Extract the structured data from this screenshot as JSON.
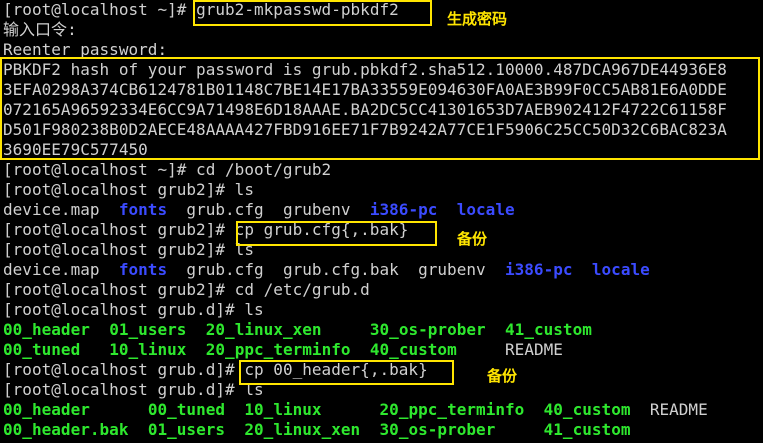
{
  "terminal": {
    "lines": [
      {
        "segments": [
          {
            "text": "[root@localhost ~]# ",
            "cls": "plain"
          },
          {
            "text": "grub2-mkpasswd-pbkdf2",
            "cls": "plain"
          }
        ]
      },
      {
        "segments": [
          {
            "text": "输入口令:",
            "cls": "plain"
          }
        ]
      },
      {
        "segments": [
          {
            "text": "Reenter password:",
            "cls": "plain"
          }
        ]
      },
      {
        "segments": [
          {
            "text": "PBKDF2 hash of your password is grub.pbkdf2.sha512.10000.487DCA967DE44936E8",
            "cls": "plain"
          }
        ]
      },
      {
        "segments": [
          {
            "text": "3EFA0298A374CB6124781B01148C7BE14E17BA33559E094630FA0AE3B99F0CC5AB81E6A0DDE",
            "cls": "plain"
          }
        ]
      },
      {
        "segments": [
          {
            "text": "072165A96592334E6CC9A71498E6D18AAAE.BA2DC5CC41301653D7AEB902412F4722C61158F",
            "cls": "plain"
          }
        ]
      },
      {
        "segments": [
          {
            "text": "D501F980238B0D2AECE48AAAA427FBD916EE71F7B9242A77CE1F5906C25CC50D32C6BAC823A",
            "cls": "plain"
          }
        ]
      },
      {
        "segments": [
          {
            "text": "3690EE79C577450",
            "cls": "plain"
          }
        ]
      },
      {
        "segments": [
          {
            "text": "[root@localhost ~]# cd /boot/grub2",
            "cls": "plain"
          }
        ]
      },
      {
        "segments": [
          {
            "text": "[root@localhost grub2]# ls",
            "cls": "plain"
          }
        ]
      },
      {
        "segments": [
          {
            "text": "device.map  ",
            "cls": "plain"
          },
          {
            "text": "fonts",
            "cls": "dir"
          },
          {
            "text": "  grub.cfg  grubenv  ",
            "cls": "plain"
          },
          {
            "text": "i386-pc",
            "cls": "dir"
          },
          {
            "text": "  ",
            "cls": "plain"
          },
          {
            "text": "locale",
            "cls": "dir"
          }
        ]
      },
      {
        "segments": [
          {
            "text": "[root@localhost grub2]# ",
            "cls": "plain"
          },
          {
            "text": "cp grub.cfg{,.bak}",
            "cls": "plain"
          }
        ]
      },
      {
        "segments": [
          {
            "text": "[root@localhost grub2]# ls",
            "cls": "plain"
          }
        ]
      },
      {
        "segments": [
          {
            "text": "device.map  ",
            "cls": "plain"
          },
          {
            "text": "fonts",
            "cls": "dir"
          },
          {
            "text": "  grub.cfg  grub.cfg.bak  grubenv  ",
            "cls": "plain"
          },
          {
            "text": "i386-pc",
            "cls": "dir"
          },
          {
            "text": "  ",
            "cls": "plain"
          },
          {
            "text": "locale",
            "cls": "dir"
          }
        ]
      },
      {
        "segments": [
          {
            "text": "[root@localhost grub2]# cd /etc/grub.d",
            "cls": "plain"
          }
        ]
      },
      {
        "segments": [
          {
            "text": "[root@localhost grub.d]# ls",
            "cls": "plain"
          }
        ]
      },
      {
        "segments": [
          {
            "text": "00_header",
            "cls": "exec"
          },
          {
            "text": "  ",
            "cls": "plain"
          },
          {
            "text": "01_users",
            "cls": "exec"
          },
          {
            "text": "  ",
            "cls": "plain"
          },
          {
            "text": "20_linux_xen",
            "cls": "exec"
          },
          {
            "text": "     ",
            "cls": "plain"
          },
          {
            "text": "30_os-prober",
            "cls": "exec"
          },
          {
            "text": "  ",
            "cls": "plain"
          },
          {
            "text": "41_custom",
            "cls": "exec"
          }
        ]
      },
      {
        "segments": [
          {
            "text": "00_tuned",
            "cls": "exec"
          },
          {
            "text": "   ",
            "cls": "plain"
          },
          {
            "text": "10_linux",
            "cls": "exec"
          },
          {
            "text": "  ",
            "cls": "plain"
          },
          {
            "text": "20_ppc_terminfo",
            "cls": "exec"
          },
          {
            "text": "  ",
            "cls": "plain"
          },
          {
            "text": "40_custom",
            "cls": "exec"
          },
          {
            "text": "     README",
            "cls": "plain"
          }
        ]
      },
      {
        "segments": [
          {
            "text": "[root@localhost grub.d]# ",
            "cls": "plain"
          },
          {
            "text": "cp 00_header{,.bak}",
            "cls": "plain"
          }
        ]
      },
      {
        "segments": [
          {
            "text": "[root@localhost grub.d]# ls",
            "cls": "plain"
          }
        ]
      },
      {
        "segments": [
          {
            "text": "00_header",
            "cls": "exec"
          },
          {
            "text": "      ",
            "cls": "plain"
          },
          {
            "text": "00_tuned",
            "cls": "exec"
          },
          {
            "text": "  ",
            "cls": "plain"
          },
          {
            "text": "10_linux",
            "cls": "exec"
          },
          {
            "text": "      ",
            "cls": "plain"
          },
          {
            "text": "20_ppc_terminfo",
            "cls": "exec"
          },
          {
            "text": "  ",
            "cls": "plain"
          },
          {
            "text": "40_custom",
            "cls": "exec"
          },
          {
            "text": "  README",
            "cls": "plain"
          }
        ]
      },
      {
        "segments": [
          {
            "text": "00_header.bak",
            "cls": "exec"
          },
          {
            "text": "  ",
            "cls": "plain"
          },
          {
            "text": "01_users",
            "cls": "exec"
          },
          {
            "text": "  ",
            "cls": "plain"
          },
          {
            "text": "20_linux_xen",
            "cls": "exec"
          },
          {
            "text": "  ",
            "cls": "plain"
          },
          {
            "text": "30_os-prober",
            "cls": "exec"
          },
          {
            "text": "     ",
            "cls": "plain"
          },
          {
            "text": "41_custom",
            "cls": "exec"
          }
        ]
      }
    ]
  },
  "annotations": {
    "generate_password": "生成密码",
    "backup_cfg": "备份",
    "backup_header": "备份"
  },
  "colors": {
    "background": "#000000",
    "text": "#d0d0d0",
    "directory": "#3b4bff",
    "executable": "#2ee82e",
    "highlight": "#ffe500"
  }
}
